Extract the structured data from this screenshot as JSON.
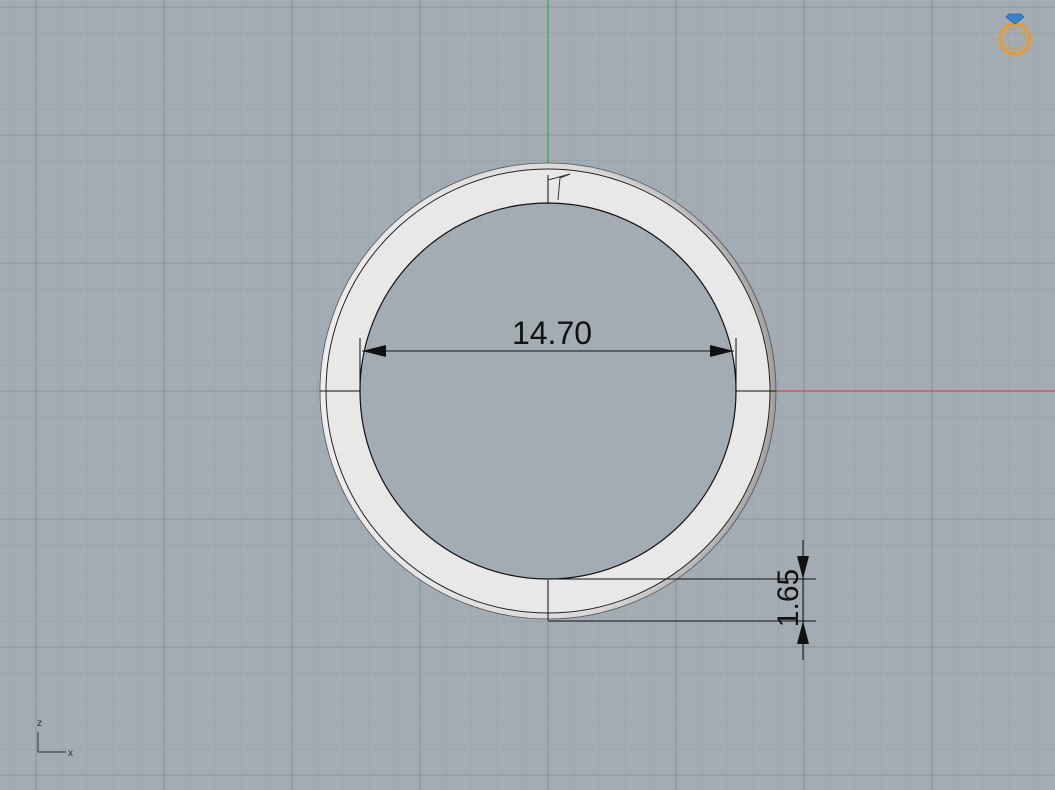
{
  "viewport": {
    "background": "#a3abb3",
    "grid_minor_color": "#99a1a9",
    "grid_major_color": "#8a929a",
    "x_axis_color": "#c85050",
    "y_axis_color": "#3fa64a"
  },
  "dimensions": {
    "inner_diameter": "14.70",
    "band_thickness": "1.65"
  },
  "axis_triad": {
    "vertical": "z",
    "horizontal": "x"
  },
  "corner_icon": "ring-gem-icon",
  "colors": {
    "icon_orange": "#e89a2a",
    "icon_gem": "#3a7fd0",
    "ring_face": "#e6e6e6",
    "ring_shade": "#bdbdbd"
  }
}
